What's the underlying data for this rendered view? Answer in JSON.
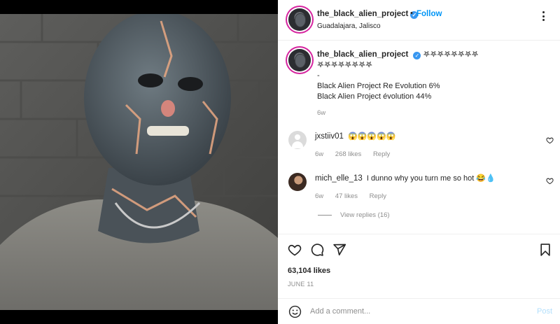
{
  "post": {
    "username": "the_black_alien_project",
    "follow_label": "Follow",
    "dot": "•",
    "location": "Guadalajara, Jalisco"
  },
  "caption": {
    "username": "the_black_alien_project",
    "symbols_line1": "𖤐𖤐𖤐𖤐𖤐𖤐𖤐𖤐",
    "symbols_line2": "𖤐𖤐𖤐𖤐𖤐𖤐𖤐𖤐",
    "dash": "-",
    "line1": "Black Alien Project Re Evolution 6%",
    "line2": "Black Alien Project évolution 44%",
    "time": "6w"
  },
  "comments": [
    {
      "username": "jxstiiv01",
      "text": "😱😱😱😱😱",
      "time": "6w",
      "likes": "268 likes",
      "reply": "Reply"
    },
    {
      "username": "mich_elle_13",
      "text": "I dunno why you turn me so hot 😂💧",
      "time": "6w",
      "likes": "47 likes",
      "reply": "Reply"
    }
  ],
  "view_replies": "View replies (16)",
  "stats": {
    "likes": "63,104 likes",
    "date": "JUNE 11"
  },
  "composer": {
    "placeholder": "Add a comment...",
    "post_label": "Post"
  },
  "colors": {
    "accent": "#0095f6",
    "muted": "#8e8e8e",
    "text": "#262626"
  },
  "icons": [
    "more-icon",
    "verified-icon",
    "heart-icon",
    "comment-icon",
    "share-icon",
    "bookmark-icon",
    "emoji-icon"
  ]
}
